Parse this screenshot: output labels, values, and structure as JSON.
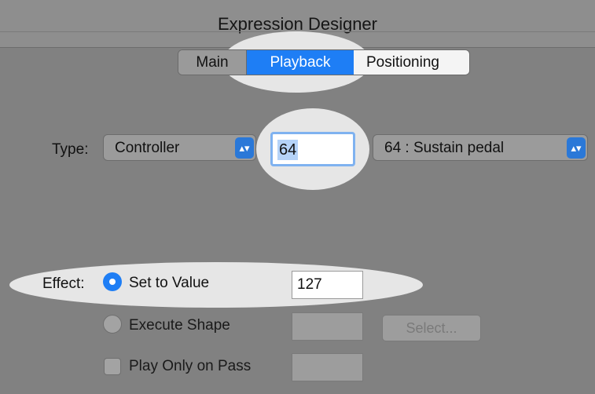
{
  "window": {
    "title": "Expression Designer"
  },
  "tabs": [
    {
      "label": "Main",
      "selected": false
    },
    {
      "label": "Playback",
      "selected": true
    },
    {
      "label": "Positioning",
      "selected": false
    }
  ],
  "type_row": {
    "label": "Type:",
    "type_value": "Controller",
    "controller_number": "64",
    "controller_name": "64 : Sustain pedal"
  },
  "effect": {
    "label": "Effect:",
    "options": [
      {
        "label": "Set to Value",
        "selected": true,
        "value": "127"
      },
      {
        "label": "Execute Shape",
        "selected": false,
        "value": "",
        "button": "Select..."
      }
    ],
    "play_only_on_pass": {
      "label": "Play Only on Pass",
      "checked": false,
      "value": ""
    }
  },
  "colors": {
    "accent": "#1e7ef5",
    "highlight": "#e6e6e6",
    "background": "#818181"
  },
  "icons": {
    "popup_arrows": "up-down-chevron-icon"
  }
}
